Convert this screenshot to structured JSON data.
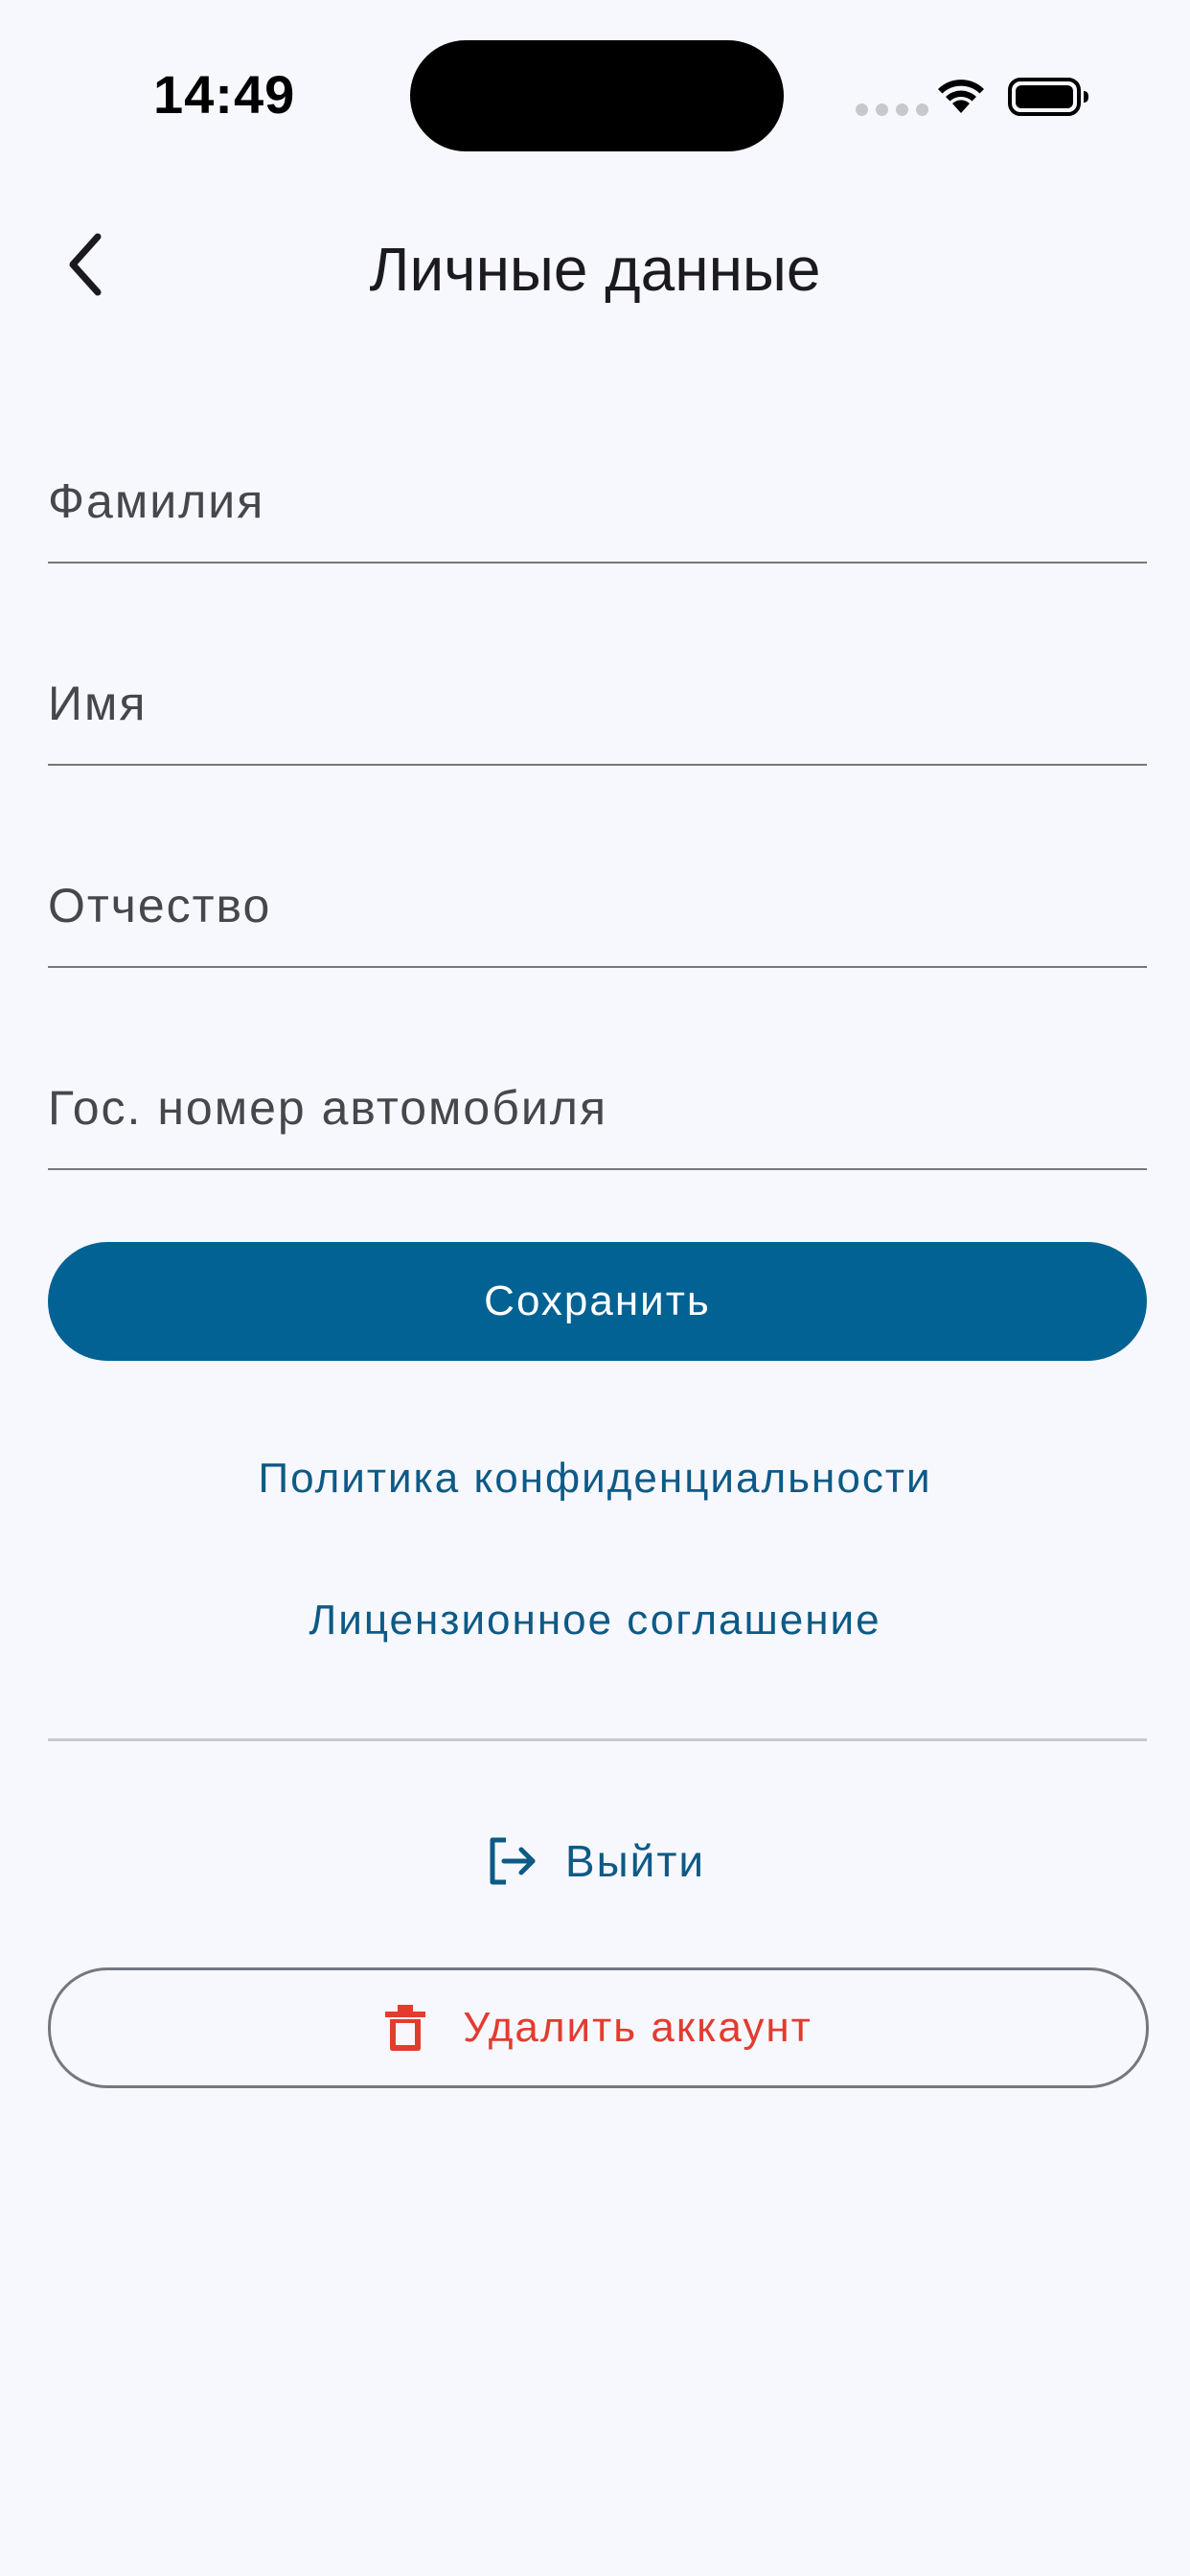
{
  "status_bar": {
    "time": "14:49"
  },
  "header": {
    "title": "Личные данные",
    "back_icon": "chevron-left-icon"
  },
  "form": {
    "last_name": {
      "placeholder": "Фамилия",
      "value": ""
    },
    "first_name": {
      "placeholder": "Имя",
      "value": ""
    },
    "patronymic": {
      "placeholder": "Отчество",
      "value": ""
    },
    "car_plate": {
      "placeholder": "Гос. номер автомобиля",
      "value": ""
    }
  },
  "actions": {
    "save_label": "Сохранить",
    "privacy_label": "Политика конфиденциальности",
    "license_label": "Лицензионное соглашение",
    "logout_label": "Выйти",
    "logout_icon": "logout-icon",
    "delete_label": "Удалить аккаунт",
    "delete_icon": "trash-icon"
  },
  "colors": {
    "background": "#f7f8fd",
    "primary": "#026293",
    "link": "#0d5a86",
    "danger": "#e23c2f",
    "outline": "#74777f"
  }
}
